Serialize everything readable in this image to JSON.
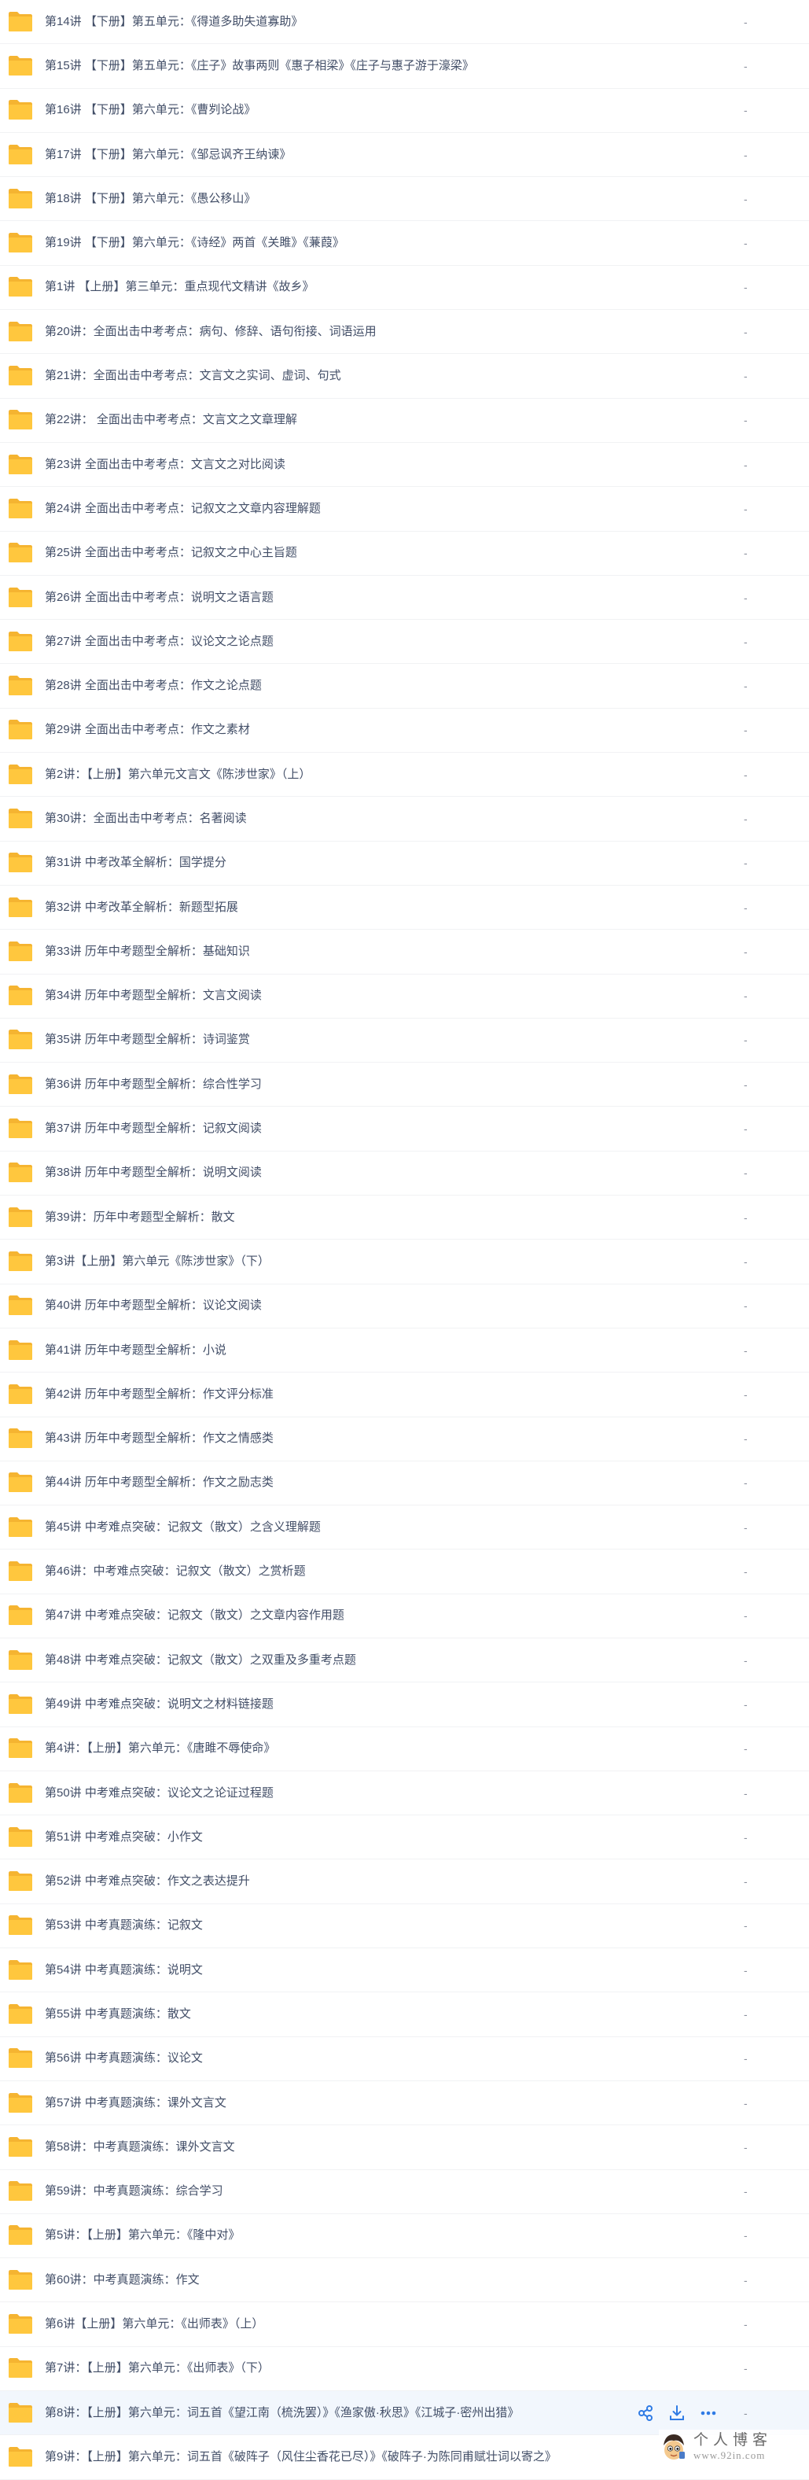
{
  "colors": {
    "folder": "#ffc73e",
    "folder_back": "#f5b431",
    "text": "#424e67",
    "muted": "#8b909d",
    "action_blue": "#2f7be5",
    "selected_row": "#f2f7fd"
  },
  "rows": [
    {
      "name": "第14讲 【下册】第五单元：《得道多助失道寡助》",
      "size": "-"
    },
    {
      "name": "第15讲 【下册】第五单元：《庄子》故事两则《惠子相梁》《庄子与惠子游于濠梁》",
      "size": "-"
    },
    {
      "name": "第16讲 【下册】第六单元：《曹刿论战》",
      "size": "-"
    },
    {
      "name": "第17讲 【下册】第六单元：《邹忌讽齐王纳谏》",
      "size": "-"
    },
    {
      "name": "第18讲 【下册】第六单元：《愚公移山》",
      "size": "-"
    },
    {
      "name": "第19讲 【下册】第六单元：《诗经》两首《关雎》《蒹葭》",
      "size": "-"
    },
    {
      "name": "第1讲 【上册】第三单元：重点现代文精讲《故乡》",
      "size": "-"
    },
    {
      "name": "第20讲：全面出击中考考点：病句、修辞、语句衔接、词语运用",
      "size": "-"
    },
    {
      "name": "第21讲：全面出击中考考点：文言文之实词、虚词、句式",
      "size": "-"
    },
    {
      "name": "第22讲： 全面出击中考考点：文言文之文章理解",
      "size": "-"
    },
    {
      "name": "第23讲 全面出击中考考点：文言文之对比阅读",
      "size": "-"
    },
    {
      "name": "第24讲 全面出击中考考点：记叙文之文章内容理解题",
      "size": "-"
    },
    {
      "name": "第25讲 全面出击中考考点：记叙文之中心主旨题",
      "size": "-"
    },
    {
      "name": "第26讲 全面出击中考考点：说明文之语言题",
      "size": "-"
    },
    {
      "name": "第27讲 全面出击中考考点：议论文之论点题",
      "size": "-"
    },
    {
      "name": "第28讲 全面出击中考考点：作文之论点题",
      "size": "-"
    },
    {
      "name": "第29讲 全面出击中考考点：作文之素材",
      "size": "-"
    },
    {
      "name": "第2讲：【上册】第六单元文言文《陈涉世家》（上）",
      "size": "-"
    },
    {
      "name": "第30讲：全面出击中考考点：名著阅读",
      "size": "-"
    },
    {
      "name": "第31讲 中考改革全解析：国学提分",
      "size": "-"
    },
    {
      "name": "第32讲 中考改革全解析：新题型拓展",
      "size": "-"
    },
    {
      "name": "第33讲 历年中考题型全解析：基础知识",
      "size": "-"
    },
    {
      "name": "第34讲 历年中考题型全解析：文言文阅读",
      "size": "-"
    },
    {
      "name": "第35讲 历年中考题型全解析：诗词鉴赏",
      "size": "-"
    },
    {
      "name": "第36讲 历年中考题型全解析：综合性学习",
      "size": "-"
    },
    {
      "name": "第37讲 历年中考题型全解析：记叙文阅读",
      "size": "-"
    },
    {
      "name": "第38讲 历年中考题型全解析：说明文阅读",
      "size": "-"
    },
    {
      "name": "第39讲：历年中考题型全解析：散文",
      "size": "-"
    },
    {
      "name": "第3讲【上册】第六单元《陈涉世家》（下）",
      "size": "-"
    },
    {
      "name": "第40讲 历年中考题型全解析：议论文阅读",
      "size": "-"
    },
    {
      "name": "第41讲 历年中考题型全解析：小说",
      "size": "-"
    },
    {
      "name": "第42讲 历年中考题型全解析：作文评分标准",
      "size": "-"
    },
    {
      "name": "第43讲 历年中考题型全解析：作文之情感类",
      "size": "-"
    },
    {
      "name": "第44讲 历年中考题型全解析：作文之励志类",
      "size": "-"
    },
    {
      "name": "第45讲 中考难点突破：记叙文（散文）之含义理解题",
      "size": "-"
    },
    {
      "name": "第46讲：中考难点突破：记叙文（散文）之赏析题",
      "size": "-"
    },
    {
      "name": "第47讲 中考难点突破：记叙文（散文）之文章内容作用题",
      "size": "-"
    },
    {
      "name": "第48讲 中考难点突破：记叙文（散文）之双重及多重考点题",
      "size": "-"
    },
    {
      "name": "第49讲 中考难点突破：说明文之材料链接题",
      "size": "-"
    },
    {
      "name": "第4讲：【上册】第六单元：《唐雎不辱使命》",
      "size": "-"
    },
    {
      "name": "第50讲 中考难点突破：议论文之论证过程题",
      "size": "-"
    },
    {
      "name": "第51讲 中考难点突破：小作文",
      "size": "-"
    },
    {
      "name": "第52讲 中考难点突破：作文之表达提升",
      "size": "-"
    },
    {
      "name": "第53讲 中考真题演练：记叙文",
      "size": "-"
    },
    {
      "name": "第54讲 中考真题演练：说明文",
      "size": "-"
    },
    {
      "name": "第55讲 中考真题演练：散文",
      "size": "-"
    },
    {
      "name": "第56讲 中考真题演练：议论文",
      "size": "-"
    },
    {
      "name": "第57讲 中考真题演练：课外文言文",
      "size": "-"
    },
    {
      "name": "第58讲：中考真题演练：课外文言文",
      "size": "-"
    },
    {
      "name": "第59讲：中考真题演练：综合学习",
      "size": "-"
    },
    {
      "name": "第5讲：【上册】第六单元：《隆中对》",
      "size": "-"
    },
    {
      "name": "第60讲：中考真题演练：作文",
      "size": "-"
    },
    {
      "name": "第6讲【上册】第六单元：《出师表》（上）",
      "size": "-"
    },
    {
      "name": "第7讲：【上册】第六单元：《出师表》（下）",
      "size": "-"
    },
    {
      "name": "第8讲：【上册】第六单元：词五首《望江南（梳洗罢）》《渔家傲·秋思》《江城子·密州出猎》",
      "size": "-",
      "selected": true
    },
    {
      "name": "第9讲：【上册】第六单元：词五首《破阵子（风住尘香花已尽）》《破阵子·为陈同甫赋壮词以寄之》",
      "size": "-"
    }
  ],
  "watermark": {
    "title": "个人博客",
    "url": "www.92in.com"
  }
}
